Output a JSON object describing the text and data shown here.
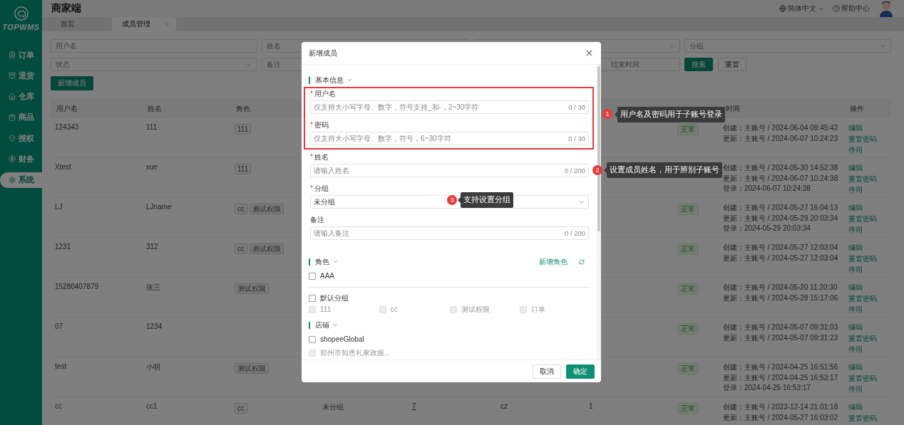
{
  "sidebar": {
    "logo": "TOPWMS",
    "items": [
      {
        "label": "订单",
        "selected": false
      },
      {
        "label": "退货",
        "selected": false
      },
      {
        "label": "仓库",
        "selected": false
      },
      {
        "label": "商品",
        "selected": false
      },
      {
        "label": "授权",
        "selected": false
      },
      {
        "label": "财务",
        "selected": false
      },
      {
        "label": "系统",
        "selected": true
      }
    ]
  },
  "header": {
    "title": "商家端",
    "language": "简体中文",
    "help": "帮助中心"
  },
  "tabs": [
    {
      "label": "首页",
      "selected": false,
      "closable": false
    },
    {
      "label": "成员管理",
      "selected": true,
      "closable": true
    }
  ],
  "filters": [
    {
      "kind": "input",
      "placeholder": "用户名"
    },
    {
      "kind": "input",
      "placeholder": "姓名"
    },
    {
      "kind": "select"
    },
    {
      "kind": "select",
      "placeholder": "分组"
    },
    {
      "kind": "select",
      "placeholder": "状态"
    },
    {
      "kind": "input",
      "placeholder": "备注"
    },
    {
      "kind": "date",
      "placeholder": "结束时间"
    }
  ],
  "search_button": "搜索",
  "reset_button": "重置",
  "add_button": "新增成员",
  "table": {
    "columns": [
      "用户名",
      "姓名",
      "角色",
      "时间",
      "操作"
    ],
    "rows": [
      {
        "username": "124343",
        "name": "111",
        "roles": [
          "111"
        ],
        "status": "正常",
        "times": [
          "创建：主账号 / 2024-06-04 09:45:42",
          "更新：主账号 / 2024-06-07 10:24:23"
        ],
        "actions": [
          "编辑",
          "重置密码",
          "停用"
        ]
      },
      {
        "username": "Xtest",
        "name": "xue",
        "roles": [
          "111"
        ],
        "times": [
          "创建：主账号 / 2024-05-30 14:52:38",
          "更新：主账号 / 2024-06-07 10:24:38",
          "登录：2024-06-07 10:24:38"
        ],
        "actions": [
          "编辑",
          "重置密码",
          "停用"
        ]
      },
      {
        "username": "LJ",
        "name": "LJname",
        "roles": [
          "cc",
          "测试权限"
        ],
        "status": "正常",
        "times": [
          "创建：主账号 / 2024-05-27 16:04:13",
          "更新：主账号 / 2024-05-29 20:03:34",
          "登录：2024-05-29 20:03:34"
        ],
        "actions": [
          "编辑",
          "重置密码",
          "停用"
        ]
      },
      {
        "username": "1231",
        "name": "312",
        "roles": [
          "cc",
          "测试权限"
        ],
        "status": "正常",
        "times": [
          "创建：主账号 / 2024-05-27 12:03:04",
          "更新：主账号 / 2024-05-27 12:03:04"
        ],
        "actions": [
          "编辑",
          "重置密码",
          "停用"
        ]
      },
      {
        "username": "15280407879",
        "name": "张三",
        "roles": [
          "测试权限"
        ],
        "status": "正常",
        "times": [
          "创建：主账号 / 2024-05-20 11:20:30",
          "更新：主账号 / 2024-05-28 15:17:06"
        ],
        "actions": [
          "编辑",
          "重置密码",
          "停用"
        ]
      },
      {
        "username": "07",
        "name": "1234",
        "status": "正常",
        "times": [
          "创建：主账号 / 2024-05-07 09:31:03",
          "更新：主账号 / 2024-05-07 09:31:23"
        ],
        "actions": [
          "编辑",
          "重置密码",
          "停用"
        ]
      },
      {
        "username": "test",
        "name": "小明",
        "roles": [
          "测试权限"
        ],
        "status": "正常",
        "times": [
          "创建：主账号 / 2024-04-25 16:51:56",
          "更新：主账号 / 2024-04-25 16:53:17",
          "登录：2024-04-25 16:53:17"
        ],
        "actions": [
          "编辑",
          "重置密码",
          "停用"
        ]
      },
      {
        "username": "cc",
        "name": "cc1",
        "roles": [
          "cc"
        ],
        "extra": [
          {
            "text": "未分组",
            "link": false
          },
          {
            "text": "7",
            "link": true
          },
          {
            "text": "cz",
            "link": false
          },
          {
            "text": "1",
            "link": false
          }
        ],
        "status": "正常",
        "times": [
          "创建：主账号 / 2023-12-14 21:01:18",
          "更新：主账号 / 2024-05-27 16:03:02"
        ],
        "actions": [
          "编辑",
          "重置密码"
        ]
      }
    ]
  },
  "dialog": {
    "title": "新增成员",
    "required_mark": "*",
    "form": {
      "title": "基本信息",
      "groups": [
        {
          "highlighted": true,
          "fields": [
            {
              "kind": "input",
              "label": "用户名",
              "required": true,
              "placeholder": "仅支持大小写字母、数字，符号支持_和-，2~30字符",
              "counter": "0 / 30"
            },
            {
              "kind": "input",
              "label": "密码",
              "required": true,
              "placeholder": "仅支持大小写字母、数字，符号，6~30字符",
              "counter": "0 / 30"
            }
          ]
        },
        {
          "highlighted": false,
          "fields": [
            {
              "kind": "input",
              "label": "姓名",
              "required": true,
              "placeholder": "请输入姓名",
              "counter": "0 / 200"
            },
            {
              "kind": "select",
              "label": "分组",
              "required": true,
              "value": "未分组"
            },
            {
              "kind": "input",
              "label": "备注",
              "required": false,
              "placeholder": "请输入备注",
              "counter": "0 / 200"
            }
          ]
        }
      ]
    },
    "roles": {
      "title": "角色",
      "action": "新增角色",
      "options": [
        {
          "label": "AAA",
          "checked": false
        }
      ],
      "group": {
        "label": "默认分组",
        "checked": false,
        "children": [
          {
            "label": "111",
            "checked": false,
            "disabled": true
          },
          {
            "label": "cc",
            "checked": false,
            "disabled": true
          },
          {
            "label": "测试权限",
            "checked": false,
            "disabled": true
          },
          {
            "label": "订单",
            "checked": false,
            "disabled": true
          }
        ]
      }
    },
    "shops": {
      "title": "店铺",
      "options": [
        {
          "label": "shopeeGlobal",
          "checked": false,
          "disabled": false
        },
        {
          "label": "郑州市知恩礼家政服...",
          "checked": false,
          "disabled": true
        }
      ]
    },
    "cancel": "取消",
    "confirm": "确定"
  },
  "annotations": [
    {
      "number": "1",
      "text": "用户名及密码用于子账号登录"
    },
    {
      "number": "2",
      "text": "设置成员姓名，用于辨别子账号"
    },
    {
      "number": "3",
      "text": "支持设置分组"
    }
  ]
}
